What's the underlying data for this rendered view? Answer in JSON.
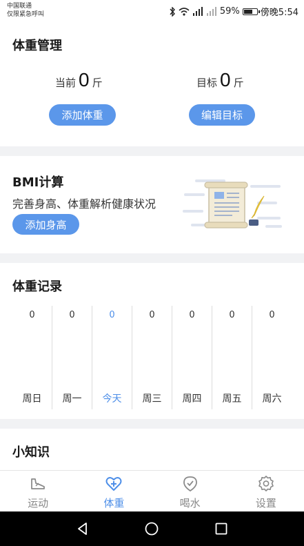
{
  "status_bar": {
    "carrier_line1": "中国联通",
    "carrier_line2": "仅限紧急呼叫",
    "battery_percent": "59%",
    "battery_level": 0.59,
    "time": "傍晚5:54"
  },
  "weight_management": {
    "title": "体重管理",
    "current_label": "当前",
    "current_value": "0",
    "current_unit": "斤",
    "target_label": "目标",
    "target_value": "0",
    "target_unit": "斤",
    "add_weight_button": "添加体重",
    "edit_target_button": "编辑目标"
  },
  "bmi": {
    "title": "BMI计算",
    "subtitle": "完善身高、体重解析健康状况",
    "add_height_button": "添加身高"
  },
  "weight_record": {
    "title": "体重记录",
    "days": [
      {
        "value": "0",
        "label": "周日"
      },
      {
        "value": "0",
        "label": "周一"
      },
      {
        "value": "0",
        "label": "今天"
      },
      {
        "value": "0",
        "label": "周三"
      },
      {
        "value": "0",
        "label": "周四"
      },
      {
        "value": "0",
        "label": "周五"
      },
      {
        "value": "0",
        "label": "周六"
      }
    ]
  },
  "tips": {
    "title": "小知识"
  },
  "bottom_nav": {
    "items": [
      {
        "label": "运动",
        "icon": "shoe-icon"
      },
      {
        "label": "体重",
        "icon": "heart-plus-icon"
      },
      {
        "label": "喝水",
        "icon": "water-drop-check-icon"
      },
      {
        "label": "设置",
        "icon": "gear-icon"
      }
    ],
    "active_index": 1,
    "accent_color": "#4e8fe8"
  },
  "colors": {
    "button_blue": "#5b97ea",
    "background": "#f1f2f4"
  }
}
